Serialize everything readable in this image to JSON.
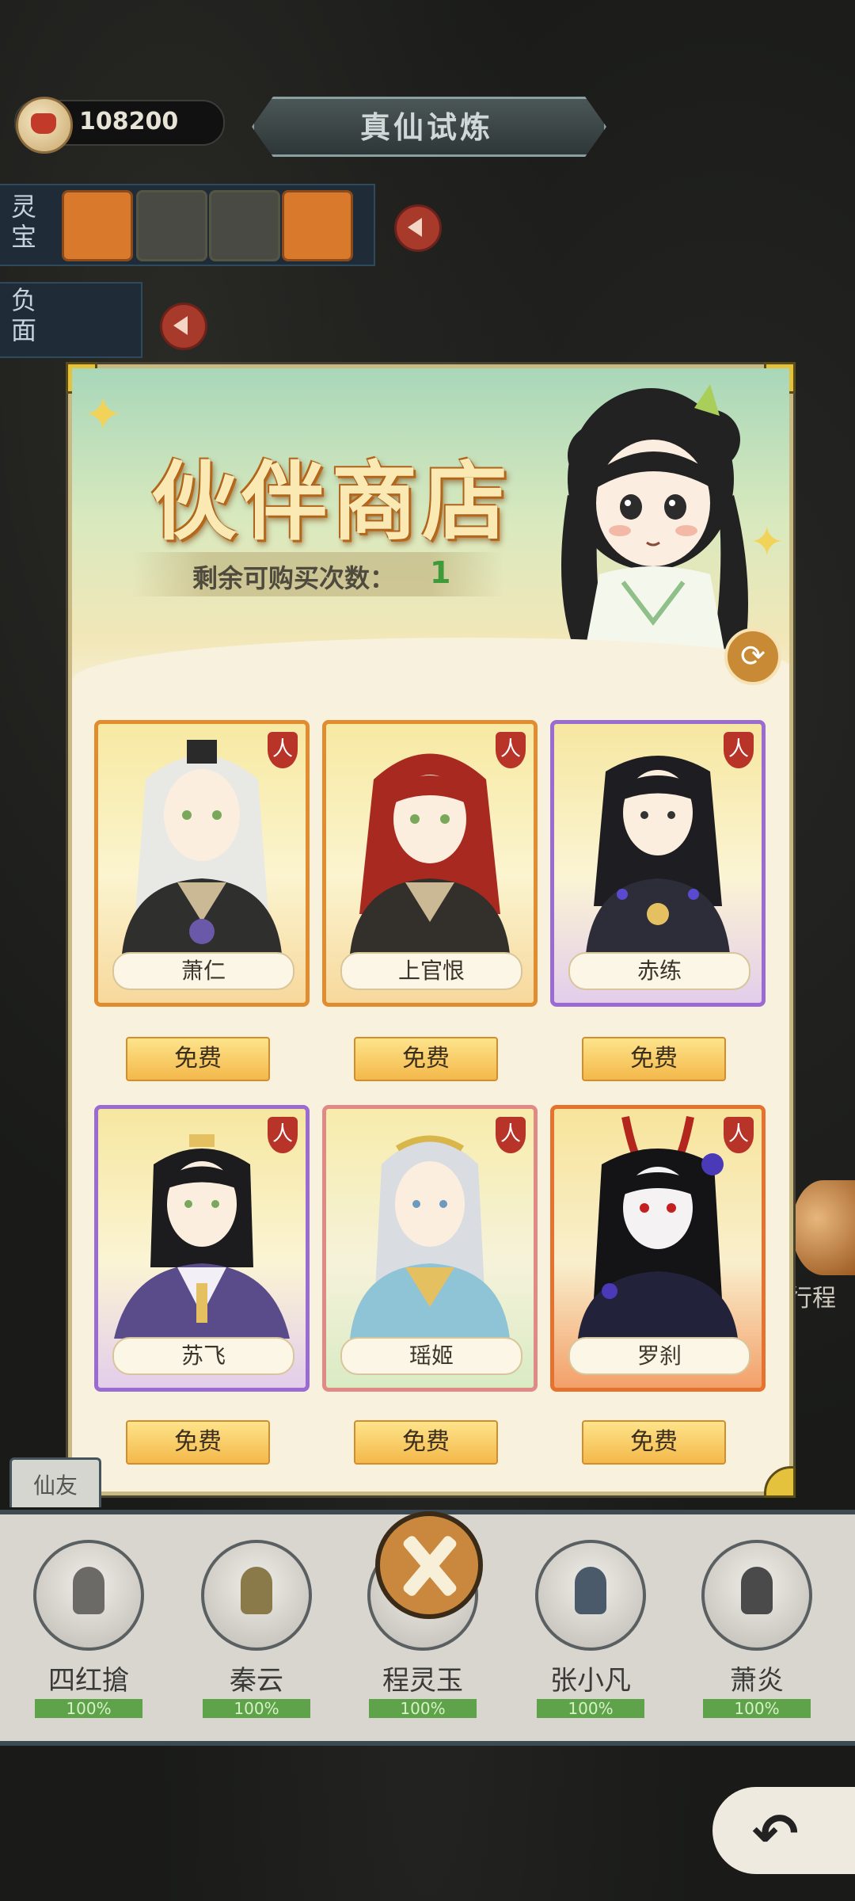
{
  "top": {
    "currency_value": "108200",
    "page_title": "真仙试炼"
  },
  "side": {
    "treasure_label": "灵宝",
    "negative_label": "负面"
  },
  "shop": {
    "title": "伙伴商店",
    "remaining_label": "剩余可购买次数：",
    "remaining_count": "1",
    "badge_char": "人",
    "cards": [
      {
        "name": "萧仁",
        "button": "免费",
        "hair": "#e8e8e4",
        "robe": "#2f2f2d",
        "frame": "orange"
      },
      {
        "name": "上官恨",
        "button": "免费",
        "hair": "#a8291f",
        "robe": "#33302c",
        "frame": "orange"
      },
      {
        "name": "赤练",
        "button": "免费",
        "hair": "#1e1e22",
        "robe": "#2d2d3a",
        "frame": "purple"
      },
      {
        "name": "苏飞",
        "button": "免费",
        "hair": "#1c1c1e",
        "robe": "#5a4b8a",
        "frame": "purple"
      },
      {
        "name": "瑶姬",
        "button": "免费",
        "hair": "#d9dde2",
        "robe": "#8fc4d6",
        "frame": "pink"
      },
      {
        "name": "罗刹",
        "button": "免费",
        "hair": "#141416",
        "robe": "#22223a",
        "frame": "orange2"
      }
    ]
  },
  "party": {
    "tab_label": "仙友",
    "members": [
      {
        "name": "四红搶",
        "hp": "100%"
      },
      {
        "name": "秦云",
        "hp": "100%"
      },
      {
        "name": "程灵玉",
        "hp": "100%"
      },
      {
        "name": "张小凡",
        "hp": "100%"
      },
      {
        "name": "萧炎",
        "hp": "100%"
      }
    ]
  },
  "peek": {
    "right_text": "行程"
  },
  "colors": {
    "accent_orange": "#e08c2f",
    "accent_purple": "#9a6bd0",
    "hp_green": "#5ea24a"
  }
}
